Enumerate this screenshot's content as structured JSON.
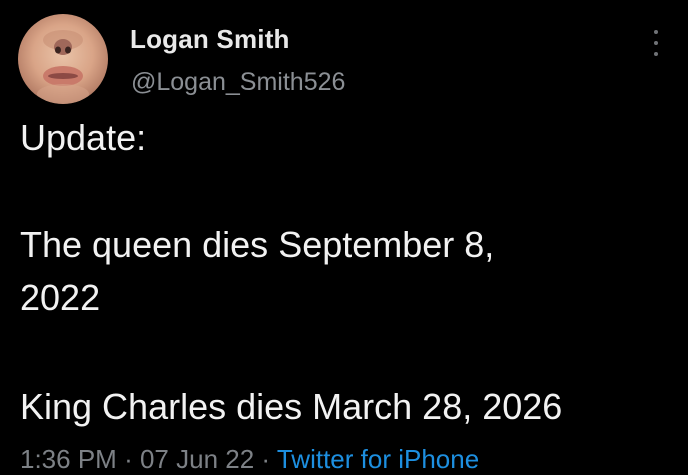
{
  "tweet": {
    "author": {
      "display_name": "Logan Smith",
      "handle": "@Logan_Smith526"
    },
    "text_lines": [
      "Update:",
      "The queen dies September 8,",
      "2022",
      "King Charles dies March 28, 2026"
    ],
    "time": "1:36 PM",
    "date": "07 Jun 22",
    "separator": "·",
    "source": "Twitter for iPhone"
  },
  "colors": {
    "background": "#000000",
    "link": "#1d8fe0",
    "secondary_text": "#8b8f94"
  },
  "icons": {
    "more": "more-vertical-icon"
  }
}
